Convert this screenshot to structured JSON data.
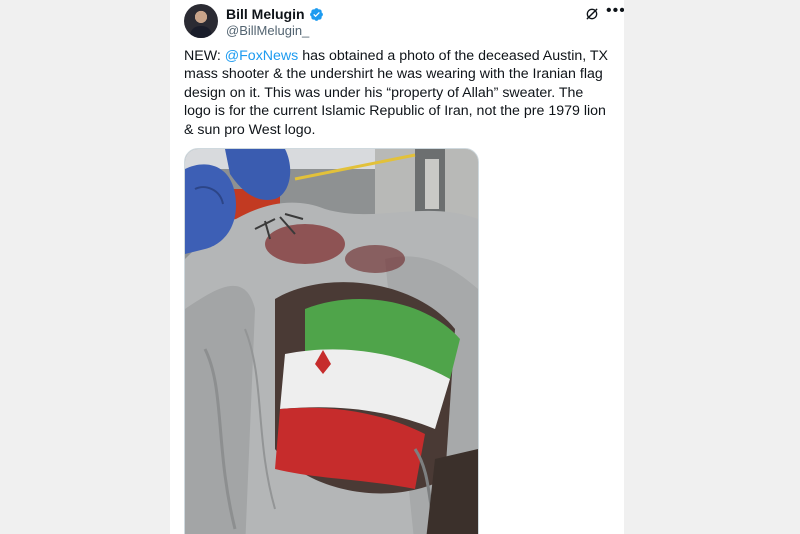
{
  "author": {
    "display_name": "Bill Melugin",
    "handle": "@BillMelugin_",
    "verified": true,
    "verified_color": "#1d9bf0"
  },
  "tweet": {
    "text_before_mention": "NEW: ",
    "mention": "@FoxNews",
    "text_after_mention": " has obtained a photo of the deceased Austin, TX mass shooter & the undershirt he was wearing with the Iranian flag design on it. This was under his “property of Allah” sweater. The logo is for the current Islamic Republic of Iran, not the pre 1979 lion & sun pro West logo.",
    "mention_color": "#1d9bf0"
  },
  "icons": {
    "grok": "grok-icon",
    "more": "more-options-icon",
    "verified": "verified-badge-icon"
  },
  "media": {
    "type": "photo"
  }
}
